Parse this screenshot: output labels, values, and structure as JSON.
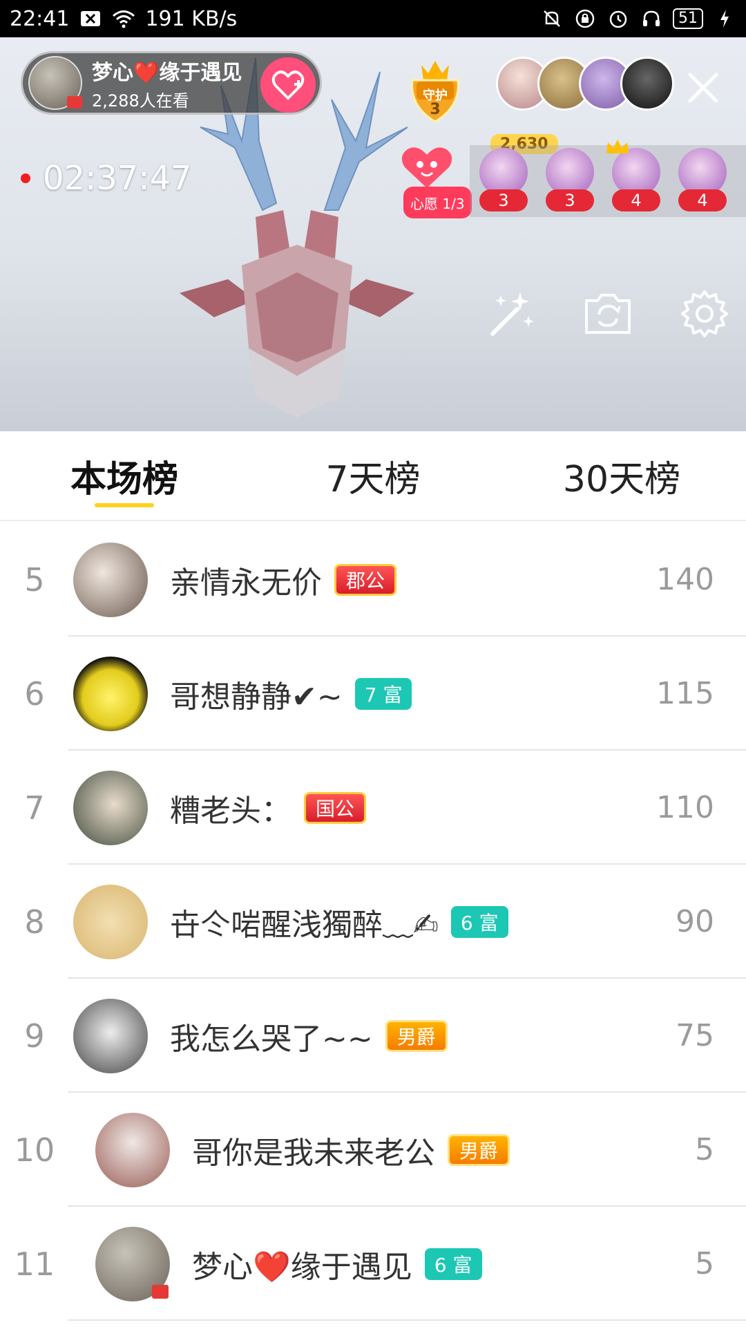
{
  "status_bar": {
    "time": "22:41",
    "speed": "191 KB/s",
    "battery": "51"
  },
  "live": {
    "host_name": "梦心❤️缘于遇见",
    "viewers": "2,288人在看",
    "guard_label": "守护",
    "guard_count": "3",
    "fan_count": "2,630",
    "timer": "02:37:47",
    "wish_label": "心愿 1/3",
    "gift_counts": [
      "3",
      "3",
      "4",
      "4"
    ]
  },
  "tabs": [
    {
      "label": "本场榜",
      "active": true
    },
    {
      "label": "7天榜",
      "active": false
    },
    {
      "label": "30天榜",
      "active": false
    }
  ],
  "ranking": [
    {
      "rank": "5",
      "name": "亲情永无价",
      "badge": "郡公",
      "badge_style": "red",
      "score": "140"
    },
    {
      "rank": "6",
      "name": "哥想静静✔~",
      "badge": "7 富",
      "badge_style": "teal",
      "score": "115"
    },
    {
      "rank": "7",
      "name": "糟老头：",
      "badge": "国公",
      "badge_style": "red",
      "score": "110"
    },
    {
      "rank": "8",
      "name": "卋仒啱醒浅獨醉﹏✍",
      "badge": "6 富",
      "badge_style": "teal",
      "score": "90"
    },
    {
      "rank": "9",
      "name": "我怎么哭了~~",
      "badge": "男爵",
      "badge_style": "orange",
      "score": "75"
    },
    {
      "rank": "10",
      "name": "哥你是我未来老公",
      "badge": "男爵",
      "badge_style": "orange",
      "score": "5"
    },
    {
      "rank": "11",
      "name": "梦心❤️缘于遇见",
      "badge": "6 富",
      "badge_style": "teal",
      "score": "5"
    }
  ],
  "colors": {
    "accent_yellow": "#ffd11a",
    "follow_pink": "#ff4f7a",
    "badge_teal": "#1cc7b4",
    "live_red": "#f01e1e"
  }
}
